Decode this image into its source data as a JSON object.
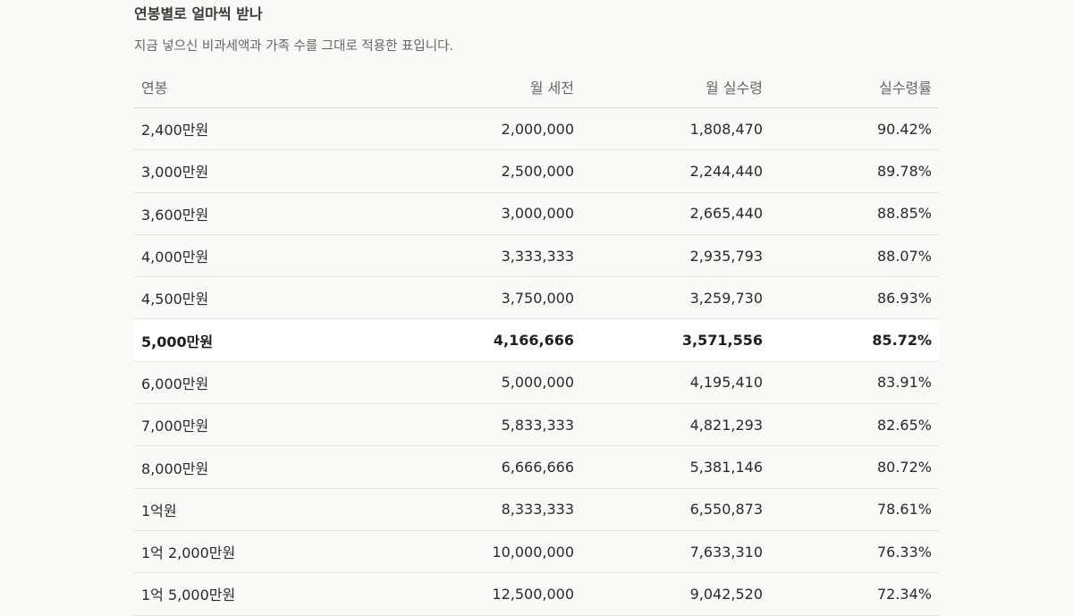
{
  "section": {
    "title": "연봉별로 얼마씩 받나",
    "description": "지금 넣으신 비과세액과 가족 수를 그대로 적용한 표입니다."
  },
  "table": {
    "headers": [
      "연봉",
      "월 세전",
      "월 실수령",
      "실수령률"
    ],
    "rows": [
      {
        "salary": "2,400만원",
        "pretax": "2,000,000",
        "net": "1,808,470",
        "rate": "90.42%",
        "highlight": false
      },
      {
        "salary": "3,000만원",
        "pretax": "2,500,000",
        "net": "2,244,440",
        "rate": "89.78%",
        "highlight": false
      },
      {
        "salary": "3,600만원",
        "pretax": "3,000,000",
        "net": "2,665,440",
        "rate": "88.85%",
        "highlight": false
      },
      {
        "salary": "4,000만원",
        "pretax": "3,333,333",
        "net": "2,935,793",
        "rate": "88.07%",
        "highlight": false
      },
      {
        "salary": "4,500만원",
        "pretax": "3,750,000",
        "net": "3,259,730",
        "rate": "86.93%",
        "highlight": false
      },
      {
        "salary": "5,000만원",
        "pretax": "4,166,666",
        "net": "3,571,556",
        "rate": "85.72%",
        "highlight": true
      },
      {
        "salary": "6,000만원",
        "pretax": "5,000,000",
        "net": "4,195,410",
        "rate": "83.91%",
        "highlight": false
      },
      {
        "salary": "7,000만원",
        "pretax": "5,833,333",
        "net": "4,821,293",
        "rate": "82.65%",
        "highlight": false
      },
      {
        "salary": "8,000만원",
        "pretax": "6,666,666",
        "net": "5,381,146",
        "rate": "80.72%",
        "highlight": false
      },
      {
        "salary": "1억원",
        "pretax": "8,333,333",
        "net": "6,550,873",
        "rate": "78.61%",
        "highlight": false
      },
      {
        "salary": "1억 2,000만원",
        "pretax": "10,000,000",
        "net": "7,633,310",
        "rate": "76.33%",
        "highlight": false
      },
      {
        "salary": "1억 5,000만원",
        "pretax": "12,500,000",
        "net": "9,042,520",
        "rate": "72.34%",
        "highlight": false
      }
    ]
  },
  "colors": {
    "background": "#faf9f6",
    "highlight_row": "#ffffff",
    "divider": "#e6e4de"
  }
}
